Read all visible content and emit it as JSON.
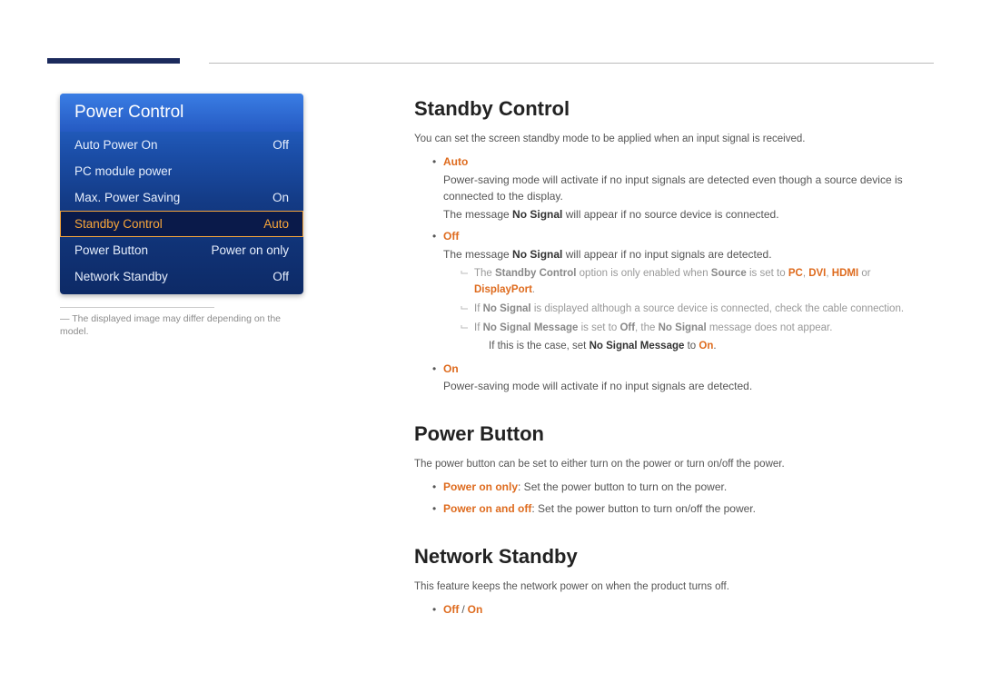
{
  "menu": {
    "title": "Power Control",
    "items": [
      {
        "label": "Auto Power On",
        "value": "Off"
      },
      {
        "label": "PC module power",
        "value": ""
      },
      {
        "label": "Max. Power Saving",
        "value": "On"
      },
      {
        "label": "Standby Control",
        "value": "Auto"
      },
      {
        "label": "Power Button",
        "value": "Power on only"
      },
      {
        "label": "Network Standby",
        "value": "Off"
      }
    ],
    "footnote": "The displayed image may differ depending on the model."
  },
  "sections": {
    "standby": {
      "heading": "Standby Control",
      "intro": "You can set the screen standby mode to be applied when an input signal is received.",
      "auto_label": "Auto",
      "auto_line1": "Power-saving mode will activate if no input signals are detected even though a source device is connected to the display.",
      "auto_line2_before": "The message ",
      "auto_line2_bold": "No Signal",
      "auto_line2_after": " will appear if no source device is connected.",
      "off_label": "Off",
      "off_line_before": "The message ",
      "off_line_bold": "No Signal",
      "off_line_after": " will appear if no input signals are detected.",
      "note1_a": "The ",
      "note1_b": "Standby Control",
      "note1_c": " option is only enabled when ",
      "note1_d": "Source",
      "note1_e": " is set to ",
      "note1_pc": "PC",
      "note1_dvi": "DVI",
      "note1_hdmi": "HDMI",
      "note1_or": " or ",
      "note1_dp": "DisplayPort",
      "note1_end": ".",
      "note2_a": "If ",
      "note2_b": "No Signal",
      "note2_c": " is displayed although a source device is connected, check the cable connection.",
      "note3_a": "If ",
      "note3_b": "No Signal Message",
      "note3_c": " is set to ",
      "note3_d": "Off",
      "note3_e": ", the ",
      "note3_f": "No Signal",
      "note3_g": " message does not appear.",
      "note3_sub_a": "If this is the case, set ",
      "note3_sub_b": "No Signal Message",
      "note3_sub_c": " to ",
      "note3_sub_d": "On",
      "note3_sub_e": ".",
      "on_label": "On",
      "on_text": "Power-saving mode will activate if no input signals are detected."
    },
    "powerbutton": {
      "heading": "Power Button",
      "intro": "The power button can be set to either turn on the power or turn on/off the power.",
      "opt1_label": "Power on only",
      "opt1_text": ": Set the power button to turn on the power.",
      "opt2_label": "Power on and off",
      "opt2_text": ": Set the power button to turn on/off the power."
    },
    "network": {
      "heading": "Network Standby",
      "intro": "This feature keeps the network power on when the product turns off.",
      "off": "Off",
      "on": "On"
    }
  }
}
